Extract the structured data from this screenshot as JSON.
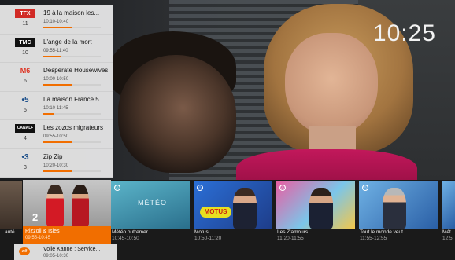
{
  "clock": "10:25",
  "channels": [
    {
      "logo": "TFX",
      "number": "11",
      "title": "19 à la maison les...",
      "time": "10:10-10:40",
      "progress": 0.5
    },
    {
      "logo": "TMC",
      "number": "10",
      "title": "L'ange de la mort",
      "time": "09:55-11:40",
      "progress": 0.3
    },
    {
      "logo": "M6",
      "number": "6",
      "title": "Desperate Housewives",
      "time": "10:00-10:50",
      "progress": 0.5
    },
    {
      "logo": "•5",
      "number": "5",
      "title": "La maison France 5",
      "time": "10:10-11:45",
      "progress": 0.18
    },
    {
      "logo": "CANAL+",
      "number": "4",
      "title": "Les zozos migrateurs",
      "time": "09:55-10:50",
      "progress": 0.5
    },
    {
      "logo": "•3",
      "number": "3",
      "title": "Zip Zip",
      "time": "10:20-10:30",
      "progress": 0.5
    }
  ],
  "carousel": {
    "left_partial": {
      "title": "auté"
    },
    "selected": {
      "number": "2",
      "title": "Rizzoli & Isles",
      "time": "09:55-10:45"
    },
    "cards": [
      {
        "title": "Météo outremer",
        "time": "10:45-10:50",
        "image_text": "MÉTÉO"
      },
      {
        "title": "Motus",
        "time": "10:50-11:20",
        "image_text": "MOTUS"
      },
      {
        "title": "Les Z'amours",
        "time": "11:20-11:55"
      },
      {
        "title": "Tout le monde veut...",
        "time": "11:55-12:55"
      }
    ],
    "right_partial": {
      "title": "Mét",
      "time": "12:5"
    }
  },
  "next_channel": {
    "logo": "zdf",
    "title": "Volle Kanne : Service...",
    "time": "09:05-10:30"
  },
  "colors": {
    "accent": "#f16e00",
    "list_bg": "#ebebeb"
  }
}
